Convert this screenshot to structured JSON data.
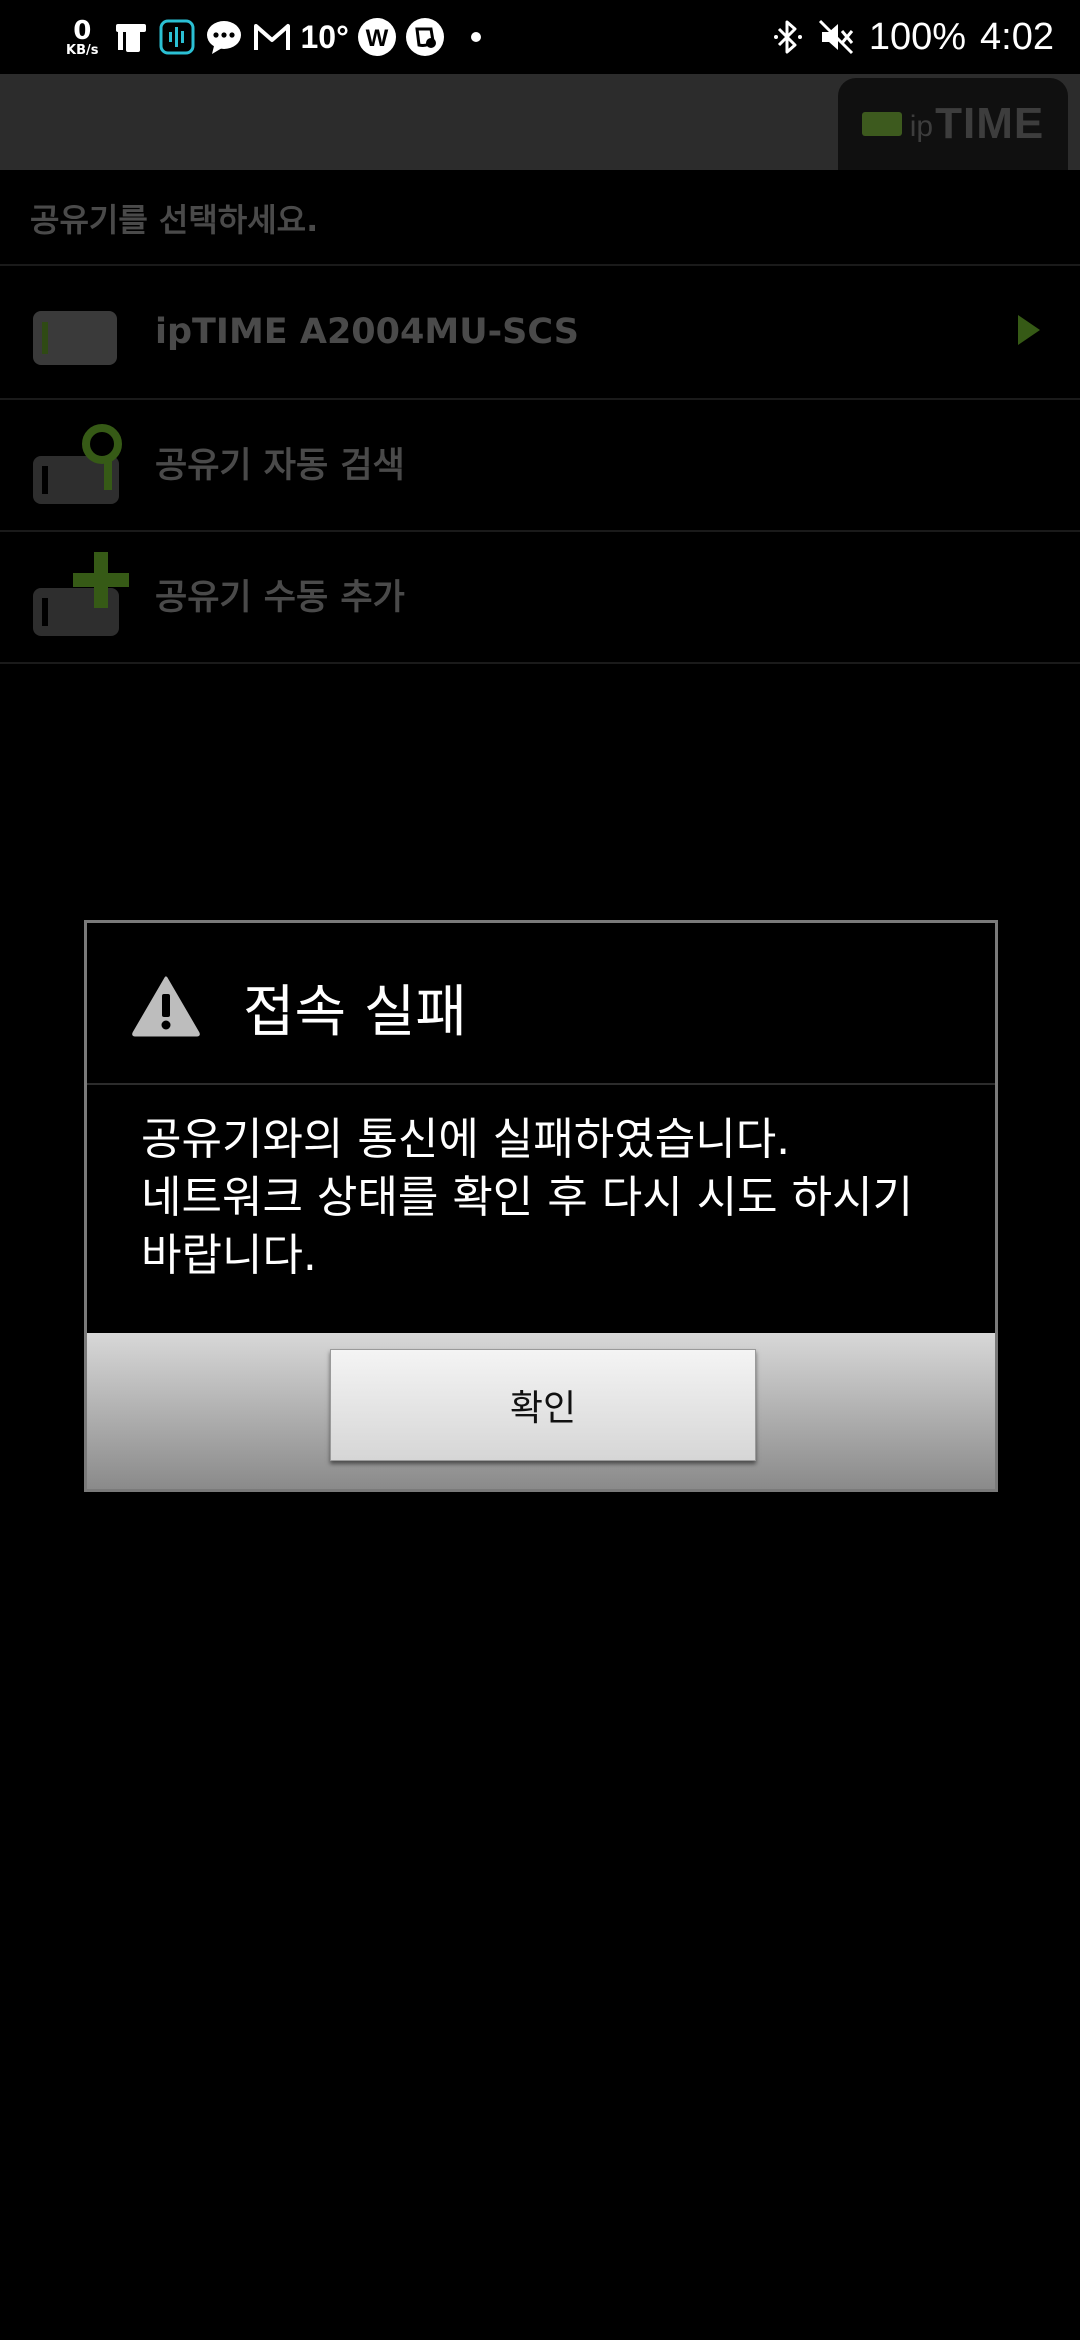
{
  "status_bar": {
    "net_speed": "0",
    "net_unit": "KB/s",
    "temperature": "10°",
    "battery": "100%",
    "time": "4:02"
  },
  "header": {
    "logo_ip": "ip",
    "logo_time": "TIME"
  },
  "list": {
    "heading": "공유기를 선택하세요.",
    "items": [
      {
        "label": "ipTIME A2004MU-SCS",
        "icon": "router-icon"
      },
      {
        "label": "공유기 자동 검색",
        "icon": "router-search-icon"
      },
      {
        "label": "공유기 수동 추가",
        "icon": "router-add-icon"
      }
    ]
  },
  "dialog": {
    "title": "접속 실패",
    "message_lines": [
      "공유기와의 통신에 실패하였습니다.",
      "네트워크 상태를 확인 후 다시 시도 하시기",
      "바랍니다."
    ],
    "ok_label": "확인"
  },
  "colors": {
    "background": "#000000",
    "header_bar": "#2c2c2c",
    "accent_green": "#3d5a1e",
    "list_text": "#4a4a4a",
    "dialog_border": "#7a7a7a"
  }
}
